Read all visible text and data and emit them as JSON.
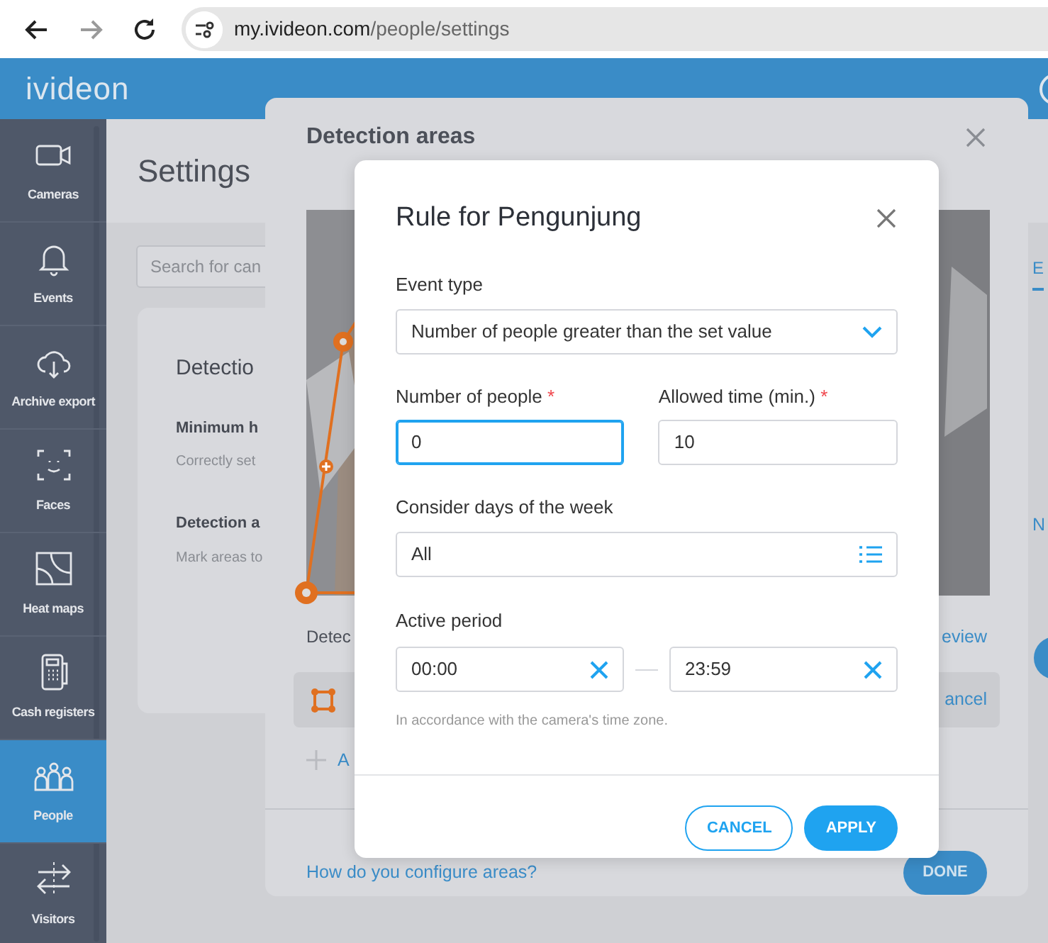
{
  "browser": {
    "nav": [
      {
        "kind": "back",
        "disabled": false
      },
      {
        "kind": "forward",
        "disabled": true
      },
      {
        "kind": "reload",
        "disabled": false
      }
    ],
    "url_host": "my.ivideon.com",
    "url_path": "/people/settings"
  },
  "app": {
    "logo": "ivideon"
  },
  "sidebar": {
    "items": [
      {
        "kind": "camera",
        "label": "Cameras",
        "selected": false
      },
      {
        "kind": "bell",
        "label": "Events",
        "selected": false
      },
      {
        "kind": "cloud",
        "label": "Archive export",
        "selected": false
      },
      {
        "kind": "face",
        "label": "Faces",
        "selected": false
      },
      {
        "kind": "heatmap",
        "label": "Heat maps",
        "selected": false
      },
      {
        "kind": "register",
        "label": "Cash registers",
        "selected": false
      },
      {
        "kind": "people",
        "label": "People",
        "selected": true
      },
      {
        "kind": "arrows",
        "label": "Visitors",
        "selected": false
      }
    ]
  },
  "page": {
    "title": "Settings",
    "search": {
      "placeholder": "Search for can"
    },
    "right_tab": "E",
    "right_link": "N",
    "card": {
      "title": "Detectio",
      "sections": [
        {
          "title": "Minimum h",
          "hint": "Correctly set"
        },
        {
          "title": "Detection a",
          "hint": "Mark areas to"
        }
      ]
    }
  },
  "detection_modal": {
    "title": "Detection areas",
    "list_label": "Detec",
    "preview_link": "eview",
    "area_row": {
      "action": "ancel"
    },
    "add_label": "A",
    "help_link": "How do you configure areas?",
    "done_button": "DONE"
  },
  "rule_dialog": {
    "title": "Rule for Pengunjung",
    "event_type": {
      "label": "Event type",
      "value": "Number of people greater than the set value"
    },
    "number_of_people": {
      "label": "Number of people",
      "required_mark": "*",
      "value": "0",
      "focused": true
    },
    "allowed_time": {
      "label": "Allowed time (min.)",
      "required_mark": "*",
      "value": "10",
      "focused": false
    },
    "days": {
      "label": "Consider days of the week",
      "value": "All"
    },
    "active_period": {
      "label": "Active period",
      "from": "00:00",
      "to": "23:59",
      "note": "In accordance with the camera's time zone."
    },
    "buttons": [
      {
        "kind": "outline",
        "label": "CANCEL"
      },
      {
        "kind": "primary",
        "label": "APPLY"
      }
    ]
  }
}
